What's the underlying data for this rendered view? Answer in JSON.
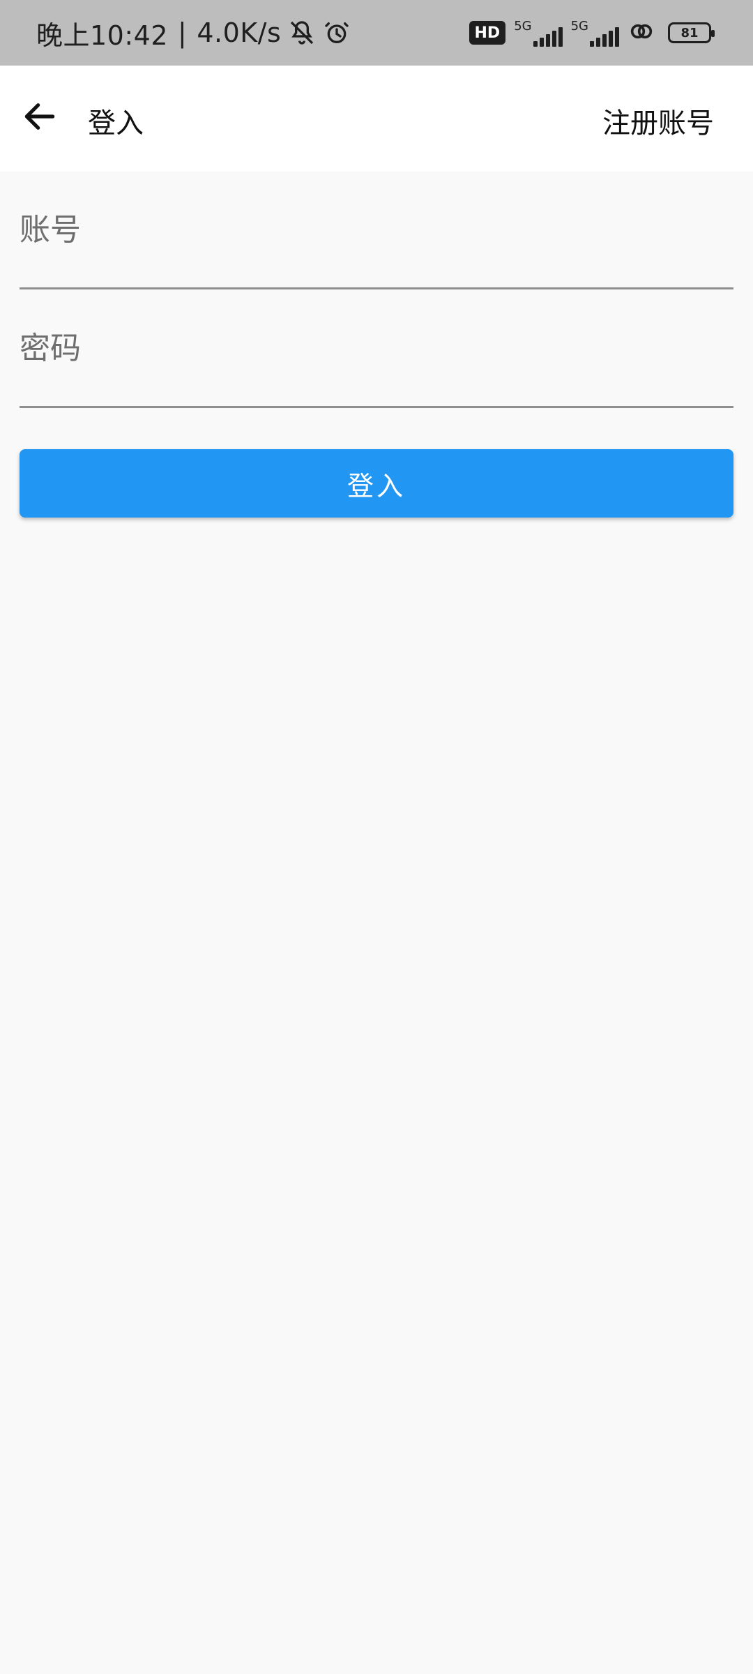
{
  "status_bar": {
    "time": "晚上10:42",
    "separator": "|",
    "speed": "4.0K/s",
    "hd_label": "HD",
    "network_1": "5G",
    "network_2": "5G",
    "battery": "81",
    "icons": [
      "bell-off-icon",
      "alarm-clock-icon",
      "hd-badge-icon",
      "signal-5g-icon",
      "signal-5g-icon",
      "link-icon",
      "battery-icon"
    ]
  },
  "app_bar": {
    "title": "登入",
    "register_label": "注册账号"
  },
  "form": {
    "account_placeholder": "账号",
    "password_placeholder": "密码",
    "account_value": "",
    "password_value": "",
    "login_label": "登入"
  },
  "colors": {
    "status_bar_bg": "#BDBDBD",
    "app_bar_bg": "#FFFFFF",
    "page_bg": "#F9F9F9",
    "accent": "#2196F3",
    "text": "#111111",
    "underline": "#8F8F8F"
  }
}
